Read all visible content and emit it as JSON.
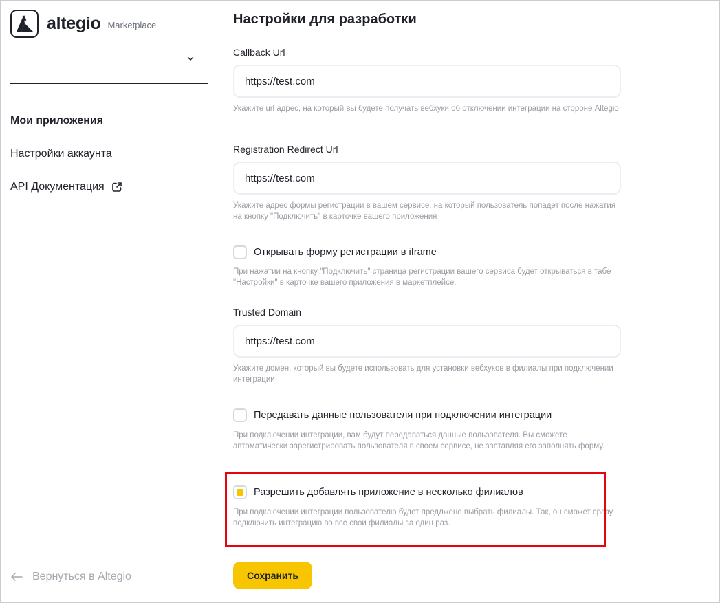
{
  "brand": {
    "name": "altegio",
    "sub": "Marketplace"
  },
  "sidebar": {
    "selector_value": "",
    "items": [
      {
        "label": "Мои приложения",
        "active": true
      },
      {
        "label": "Настройки аккаунта",
        "active": false
      },
      {
        "label": "API Документация",
        "active": false,
        "external": true
      }
    ],
    "back_label": "Вернуться в Altegio"
  },
  "main": {
    "title": "Настройки для разработки",
    "callback": {
      "label": "Callback Url",
      "value": "https://test.com",
      "hint": "Укажите url адрес, на который вы будете получать вебхуки об отключении интеграции на стороне Altegio"
    },
    "redirect": {
      "label": "Registration Redirect Url",
      "value": "https://test.com",
      "hint": "Укажите адрес формы регистрации в вашем сервисе, на который пользователь попадет после нажатия на кнопку \"Подключить\" в карточке вашего приложения"
    },
    "iframe": {
      "label": "Открывать форму регистрации в iframe",
      "checked": false,
      "hint": "При нажатии на кнопку \"Подключить\" страница регистрации вашего сервиса будет открываться в табе \"Настройки\" в карточке вашего приложения в маркетплейсе."
    },
    "domain": {
      "label": "Trusted Domain",
      "value": "https://test.com",
      "hint": "Укажите домен, который вы будете использовать для установки вебхуков в филиалы при подключении интеграции"
    },
    "userdata": {
      "label": "Передавать данные пользователя при подключении интеграции",
      "checked": false,
      "hint": "При подключении интеграции, вам будут передаваться данные пользователя. Вы сможете автоматически зарегистрировать пользователя в своем сервисе, не заставляя его заполнять форму."
    },
    "multi": {
      "label": "Разрешить добавлять приложение в несколько филиалов",
      "checked": true,
      "hint": "При подключении интеграции пользователю будет предлжено выбрать филиалы. Так, он сможет сразу подключить интеграцию во все свои филиалы за один раз."
    },
    "save_label": "Сохранить"
  },
  "colors": {
    "accent": "#f7c600",
    "highlight": "#e6050f",
    "text": "#1f2229",
    "muted": "#9a9da4"
  }
}
